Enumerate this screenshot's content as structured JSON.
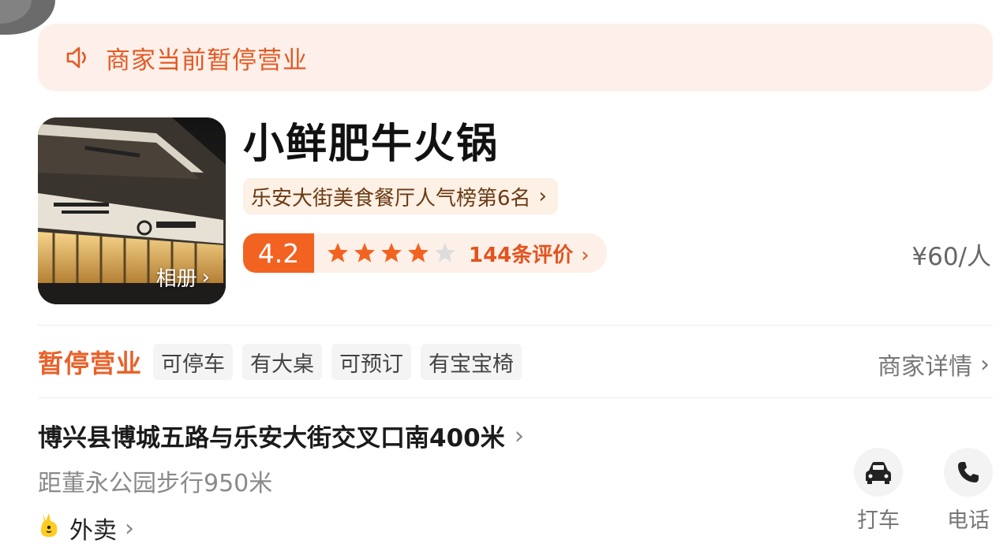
{
  "notice": {
    "text": "商家当前暂停营业",
    "icon": "speaker-icon"
  },
  "shop": {
    "name": "小鲜肥牛火锅",
    "album_label": "相册",
    "rank_tag": "乐安大街美食餐厅人气榜第6名",
    "rating": {
      "score": "4.2",
      "stars": 4.2,
      "max_stars": 5,
      "reviews": "144条评价"
    },
    "price": "¥60/人"
  },
  "status": {
    "label": "暂停营业",
    "tags": [
      "可停车",
      "有大桌",
      "可预订",
      "有宝宝椅"
    ],
    "detail_link": "商家详情"
  },
  "location": {
    "address": "博兴县博城五路与乐安大街交叉口南400米",
    "distance": "距董永公园步行950米"
  },
  "delivery": {
    "label": "外卖",
    "icon": "kangaroo-icon"
  },
  "actions": [
    {
      "label": "打车",
      "icon": "car-icon"
    },
    {
      "label": "电话",
      "icon": "phone-icon"
    }
  ],
  "colors": {
    "accent": "#f26322",
    "notice_bg": "#fdf0ea",
    "notice_text": "#e25a24",
    "star": "#f26322",
    "star_empty": "#dddddd"
  }
}
